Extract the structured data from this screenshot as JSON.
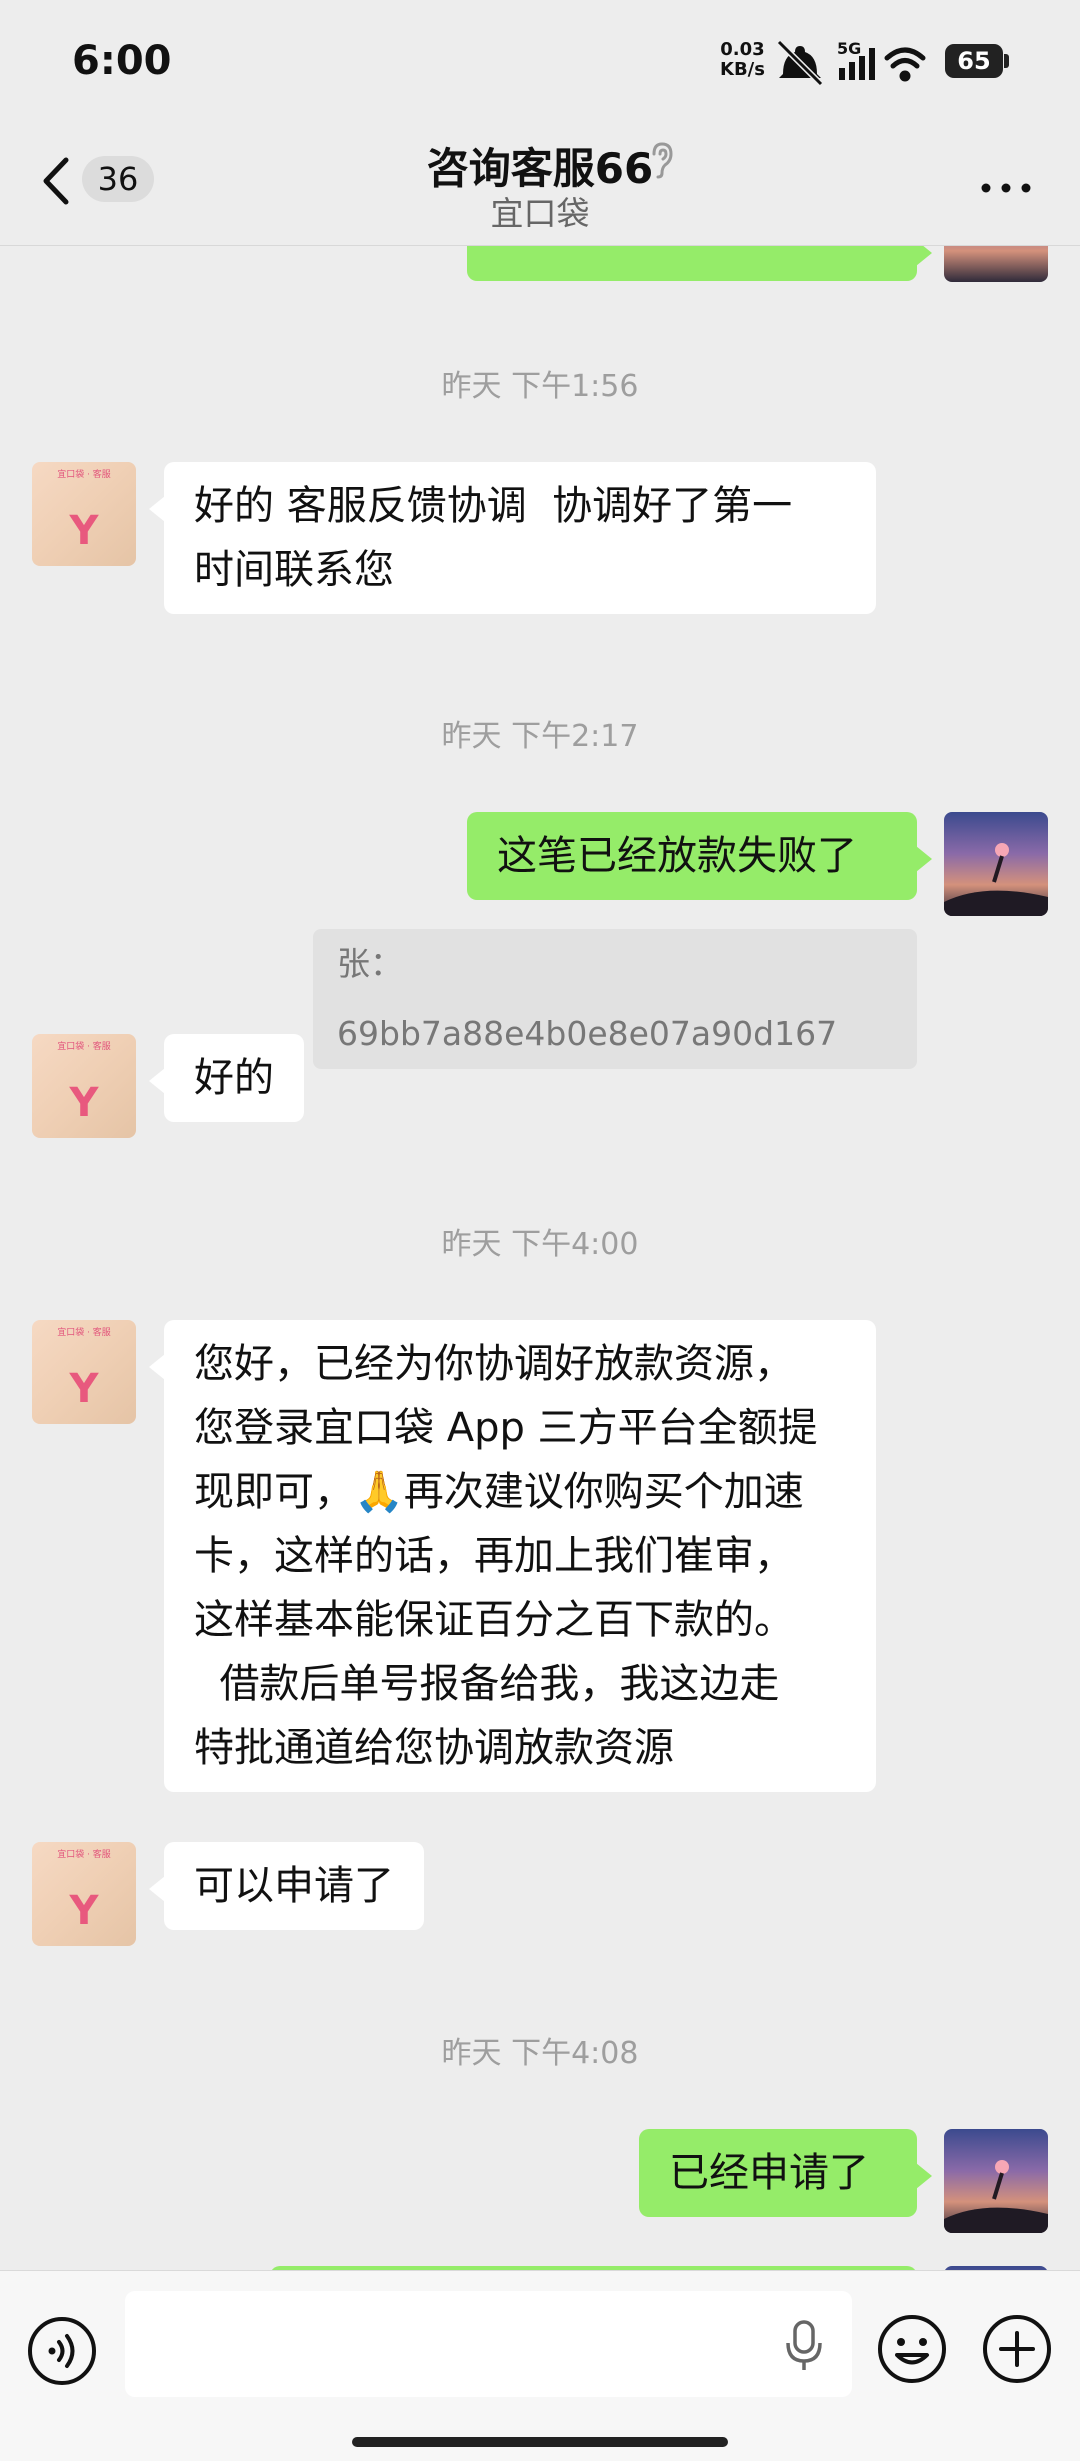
{
  "status_bar": {
    "time": "6:00",
    "net_speed_value": "0.03",
    "net_speed_unit": "KB/s",
    "signal_label": "5G",
    "battery": "65"
  },
  "header": {
    "back_badge": "36",
    "title": "咨询客服66",
    "subtitle": "宜口袋"
  },
  "messages": {
    "ts1": "昨天 下午1:56",
    "m1": "好的 客服反馈协调  协调好了第一\n时间联系您",
    "ts2": "昨天 下午2:17",
    "m2": "这笔已经放款失败了",
    "quote2": "张：69bb7a88e4b0e8e07a90d167",
    "m3": "好的",
    "ts3": "昨天 下午4:00",
    "m4": "您好，已经为你协调好放款资源，\n您登录宜口袋 App 三方平台全额提\n现即可，🙏再次建议你购买个加速\n卡，这样的话，再加上我们崔审，\n这样基本能保证百分之百下款的。\n  借款后单号报备给我，我这边走\n特批通道给您协调放款资源",
    "m5": "可以申请了",
    "ts4": "昨天 下午4:08",
    "m6": "已经申请了"
  },
  "input": {
    "placeholder": ""
  },
  "colors": {
    "background": "#ededed",
    "sent_bubble": "#95ec69",
    "received_bubble": "#ffffff",
    "timestamp": "#9e9e9e"
  },
  "icons": [
    "back-icon",
    "ear-icon",
    "more-icon",
    "voice-icon",
    "mic-icon",
    "emoji-icon",
    "plus-icon",
    "wifi-icon",
    "signal-icon",
    "mute-bell-icon"
  ]
}
